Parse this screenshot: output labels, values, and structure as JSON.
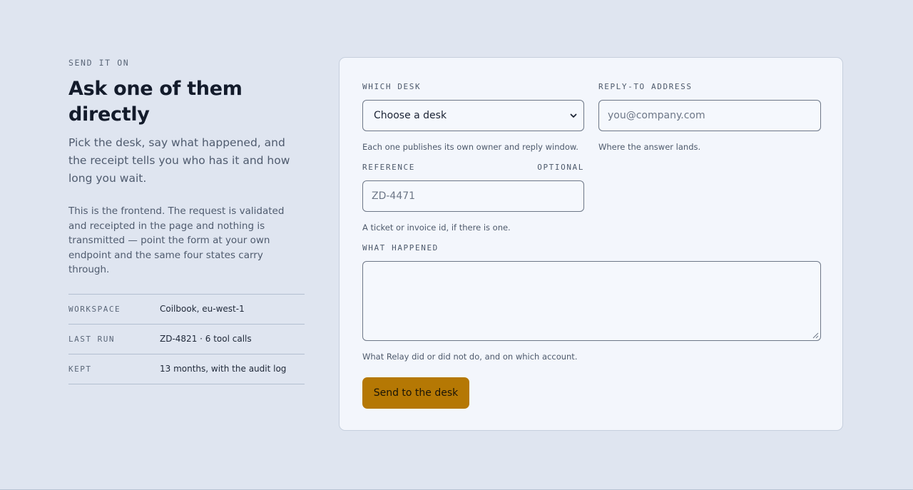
{
  "intro": {
    "eyebrow": "SEND IT ON",
    "title": "Ask one of them directly",
    "lede": "Pick the desk, say what happened, and the receipt tells you who has it and how long you wait.",
    "note": "This is the frontend. The request is validated and receipted in the page and nothing is transmitted — point the form at your own endpoint and the same four states carry through."
  },
  "meta": [
    {
      "key": "WORKSPACE",
      "value": "Coilbook, eu-west-1"
    },
    {
      "key": "LAST RUN",
      "value": "ZD-4821 · 6 tool calls"
    },
    {
      "key": "KEPT",
      "value": "13 months, with the audit log"
    }
  ],
  "form": {
    "desk": {
      "label": "WHICH DESK",
      "selected": "Choose a desk",
      "hint": "Each one publishes its own owner and reply window."
    },
    "reply_to": {
      "label": "REPLY-TO ADDRESS",
      "value": "",
      "placeholder": "you@company.com",
      "hint": "Where the answer lands."
    },
    "reference": {
      "label": "REFERENCE",
      "tag": "OPTIONAL",
      "value": "",
      "placeholder": "ZD-4471",
      "hint": "A ticket or invoice id, if there is one."
    },
    "what_happened": {
      "label": "WHAT HAPPENED",
      "value": "",
      "hint": "What Relay did or did not do, and on which account."
    },
    "submit_label": "Send to the desk"
  },
  "colors": {
    "page_bg": "#dfe5f0",
    "card_bg": "#f3f6fc",
    "accent": "#b57804"
  }
}
